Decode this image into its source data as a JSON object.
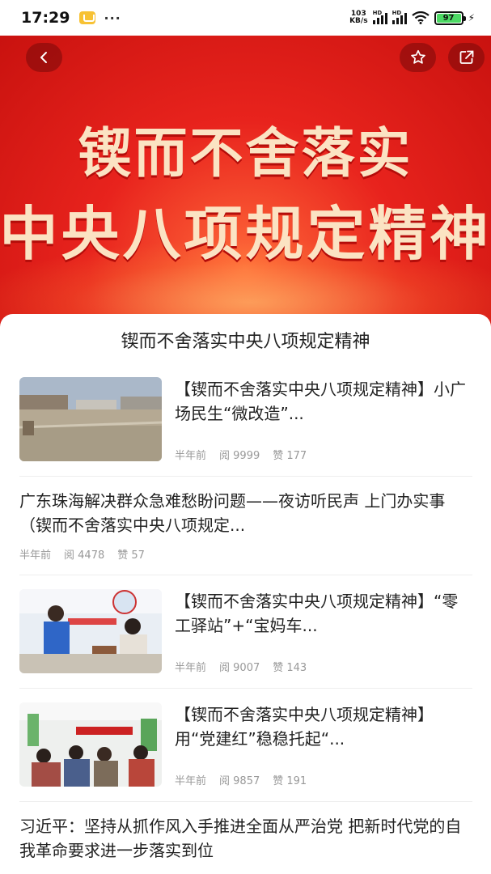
{
  "status": {
    "time": "17:29",
    "dots": "···",
    "net_speed_value": "103",
    "net_speed_unit": "KB/s",
    "hd_label": "HD",
    "battery": "97"
  },
  "banner": {
    "line1": "锲而不舍落实",
    "line2": "中央八项规定精神"
  },
  "section_title": "锲而不舍落实中央八项规定精神",
  "articles": [
    {
      "title": "【锲而不舍落实中央八项规定精神】小广场民生“微改造”...",
      "time": "半年前",
      "reads": "阅 9999",
      "likes": "赞 177"
    },
    {
      "title": "广东珠海解决群众急难愁盼问题——夜访听民声 上门办实事（锲而不舍落实中央八项规定...",
      "time": "半年前",
      "reads": "阅 4478",
      "likes": "赞 57"
    },
    {
      "title": "【锲而不舍落实中央八项规定精神】“零工驿站”+“宝妈车...",
      "time": "半年前",
      "reads": "阅 9007",
      "likes": "赞 143"
    },
    {
      "title": "【锲而不舍落实中央八项规定精神】用“党建红”稳稳托起“...",
      "time": "半年前",
      "reads": "阅 9857",
      "likes": "赞 191"
    },
    {
      "title": "习近平：坚持从抓作风入手推进全面从严治党 把新时代党的自我革命要求进一步落实到位"
    }
  ],
  "icons": {
    "back": "chevron-left-icon",
    "favorite": "star-icon",
    "share": "share-icon"
  },
  "colors": {
    "banner_red": "#e8231d",
    "banner_text": "#fbe3c3",
    "meta_gray": "#999999"
  }
}
